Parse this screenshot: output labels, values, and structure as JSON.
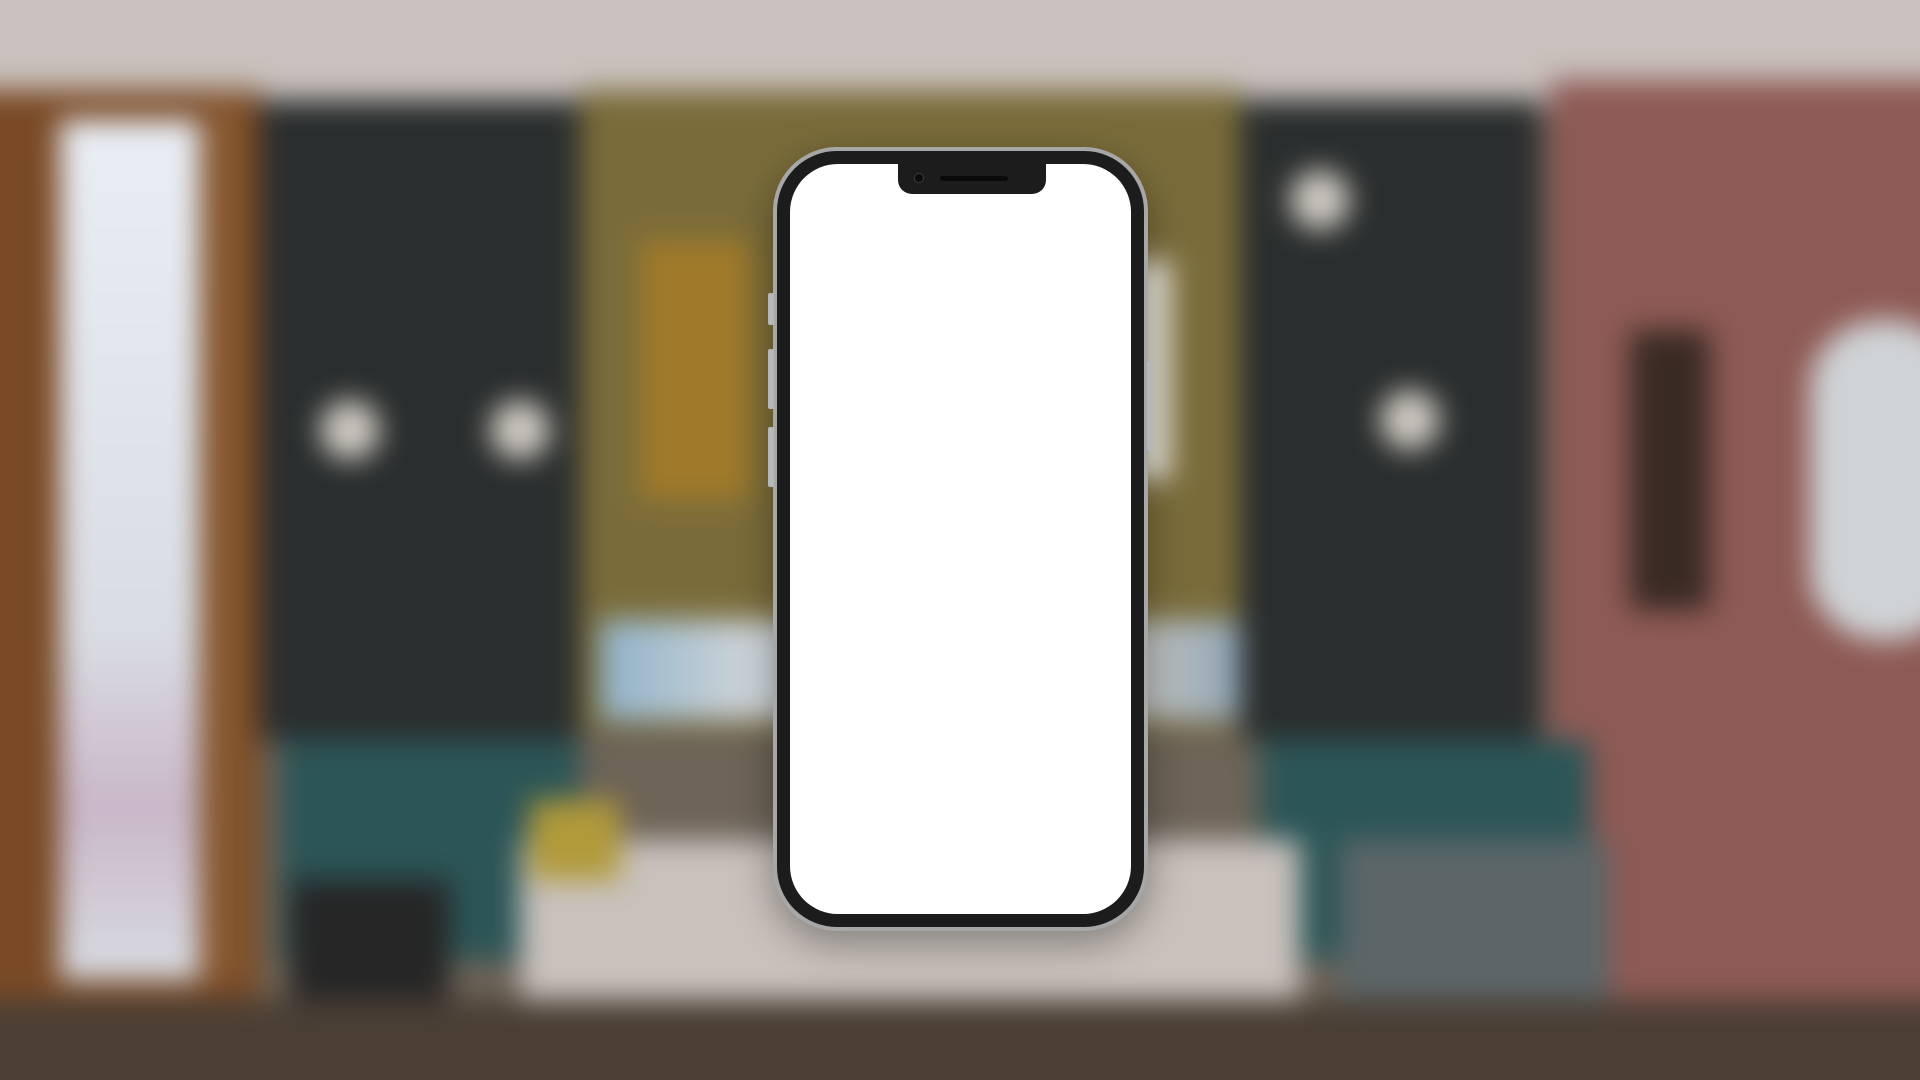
{
  "background": {
    "description_icon": "blurred-living-room-photo",
    "palette": {
      "ceiling": "#c9c1bd",
      "window_frame": "#7a4a26",
      "olive_wall": "#7a6c3a",
      "shelves": "#2a2e2e",
      "pink_wall": "#8e5a55",
      "teal_sofa": "#2c5557"
    }
  },
  "device": {
    "icon": "smartphone-mockup",
    "frame_color": "#1c1c1c",
    "bezel_color": "#a7a7a7",
    "screen_color": "#ffffff",
    "screen_content": ""
  }
}
